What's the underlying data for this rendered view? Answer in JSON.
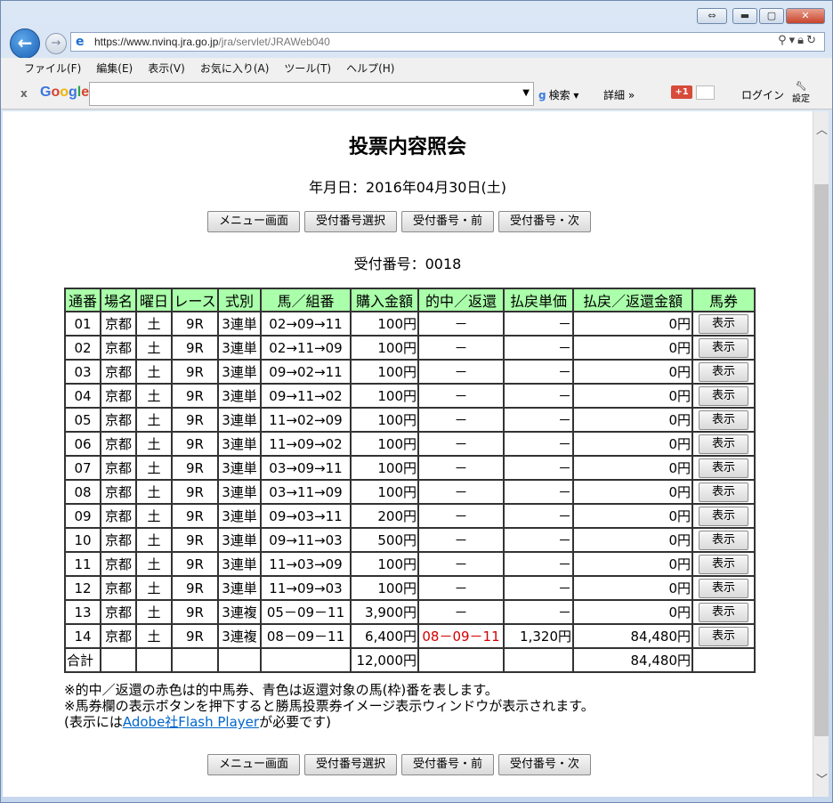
{
  "browser": {
    "url_host": "https://www.nvinq.jra.go.jp",
    "url_path": "/jra/servlet/JRAWeb040",
    "menu": [
      "ファイル(F)",
      "編集(E)",
      "表示(V)",
      "お気に入り(A)",
      "ツール(T)",
      "ヘルプ(H)"
    ],
    "google": {
      "logo": "Google",
      "search_label": "検索",
      "more_label": "詳細 »",
      "plus_label": "+1",
      "login_label": "ログイン",
      "settings_label": "設定"
    }
  },
  "page": {
    "title": "投票内容照会",
    "date_line": "年月日：2016年04月30日(土)",
    "ticket_line": "受付番号：0018",
    "buttons": {
      "menu": "メニュー画面",
      "select": "受付番号選択",
      "prev": "受付番号・前",
      "next": "受付番号・次"
    }
  },
  "table": {
    "headers": [
      "通番",
      "場名",
      "曜日",
      "レース",
      "式別",
      "馬／組番",
      "購入金額",
      "的中／返還",
      "払戻単価",
      "払戻／返還金額",
      "馬券"
    ],
    "show_label": "表示",
    "rows": [
      {
        "no": "01",
        "venue": "京都",
        "day": "土",
        "race": "9R",
        "type": "3連単",
        "combo": "02→09→11",
        "amount": "100円",
        "hit": "－",
        "unit": "－",
        "payout": "0円"
      },
      {
        "no": "02",
        "venue": "京都",
        "day": "土",
        "race": "9R",
        "type": "3連単",
        "combo": "02→11→09",
        "amount": "100円",
        "hit": "－",
        "unit": "－",
        "payout": "0円"
      },
      {
        "no": "03",
        "venue": "京都",
        "day": "土",
        "race": "9R",
        "type": "3連単",
        "combo": "09→02→11",
        "amount": "100円",
        "hit": "－",
        "unit": "－",
        "payout": "0円"
      },
      {
        "no": "04",
        "venue": "京都",
        "day": "土",
        "race": "9R",
        "type": "3連単",
        "combo": "09→11→02",
        "amount": "100円",
        "hit": "－",
        "unit": "－",
        "payout": "0円"
      },
      {
        "no": "05",
        "venue": "京都",
        "day": "土",
        "race": "9R",
        "type": "3連単",
        "combo": "11→02→09",
        "amount": "100円",
        "hit": "－",
        "unit": "－",
        "payout": "0円"
      },
      {
        "no": "06",
        "venue": "京都",
        "day": "土",
        "race": "9R",
        "type": "3連単",
        "combo": "11→09→02",
        "amount": "100円",
        "hit": "－",
        "unit": "－",
        "payout": "0円"
      },
      {
        "no": "07",
        "venue": "京都",
        "day": "土",
        "race": "9R",
        "type": "3連単",
        "combo": "03→09→11",
        "amount": "100円",
        "hit": "－",
        "unit": "－",
        "payout": "0円"
      },
      {
        "no": "08",
        "venue": "京都",
        "day": "土",
        "race": "9R",
        "type": "3連単",
        "combo": "03→11→09",
        "amount": "100円",
        "hit": "－",
        "unit": "－",
        "payout": "0円"
      },
      {
        "no": "09",
        "venue": "京都",
        "day": "土",
        "race": "9R",
        "type": "3連単",
        "combo": "09→03→11",
        "amount": "200円",
        "hit": "－",
        "unit": "－",
        "payout": "0円"
      },
      {
        "no": "10",
        "venue": "京都",
        "day": "土",
        "race": "9R",
        "type": "3連単",
        "combo": "09→11→03",
        "amount": "500円",
        "hit": "－",
        "unit": "－",
        "payout": "0円"
      },
      {
        "no": "11",
        "venue": "京都",
        "day": "土",
        "race": "9R",
        "type": "3連単",
        "combo": "11→03→09",
        "amount": "100円",
        "hit": "－",
        "unit": "－",
        "payout": "0円"
      },
      {
        "no": "12",
        "venue": "京都",
        "day": "土",
        "race": "9R",
        "type": "3連単",
        "combo": "11→09→03",
        "amount": "100円",
        "hit": "－",
        "unit": "－",
        "payout": "0円"
      },
      {
        "no": "13",
        "venue": "京都",
        "day": "土",
        "race": "9R",
        "type": "3連複",
        "combo": "05－09－11",
        "amount": "3,900円",
        "hit": "－",
        "unit": "－",
        "payout": "0円"
      },
      {
        "no": "14",
        "venue": "京都",
        "day": "土",
        "race": "9R",
        "type": "3連複",
        "combo": "08－09－11",
        "amount": "6,400円",
        "hit": "08－09－11",
        "unit": "1,320円",
        "payout": "84,480円",
        "hit_red": true
      }
    ],
    "total": {
      "label": "合計",
      "amount": "12,000円",
      "payout": "84,480円"
    }
  },
  "notes": {
    "line1": "※的中／返還の赤色は的中馬券、青色は返還対象の馬(枠)番を表します。",
    "line2": "※馬券欄の表示ボタンを押下すると勝馬投票券イメージ表示ウィンドウが表示されます。",
    "line3_pre": "(表示には",
    "line3_link": "Adobe社Flash Player",
    "line3_post": "が必要です)"
  },
  "colors": {
    "header_bg": "#aaffaa",
    "hit_red": "#d40000",
    "link": "#0066cc"
  }
}
